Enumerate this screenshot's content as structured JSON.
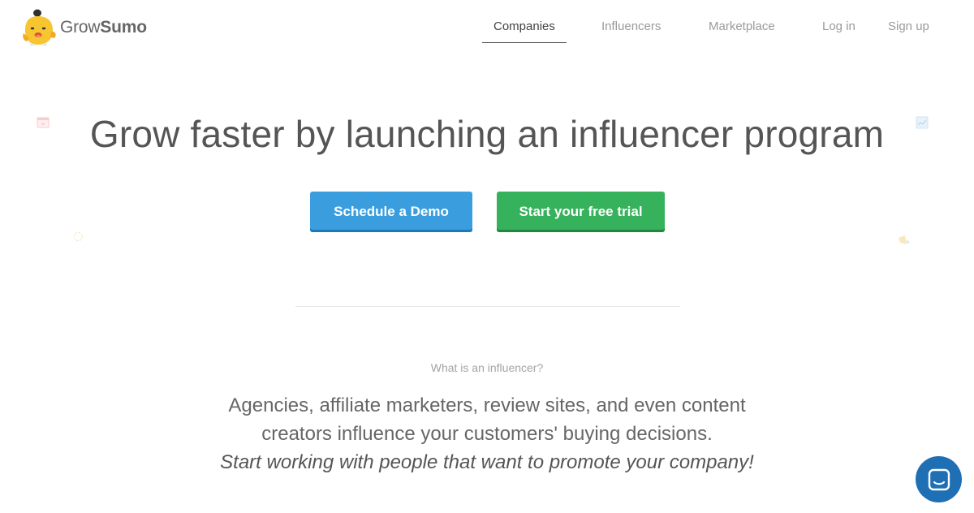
{
  "brand": {
    "name_light": "Grow",
    "name_bold": "Sumo"
  },
  "nav": {
    "items": [
      {
        "label": "Companies",
        "active": true
      },
      {
        "label": "Influencers",
        "active": false
      },
      {
        "label": "Marketplace",
        "active": false
      },
      {
        "label": "Log in",
        "active": false
      },
      {
        "label": "Sign up",
        "active": false
      }
    ]
  },
  "hero": {
    "title": "Grow faster by launching an influencer program",
    "demo_button": "Schedule a Demo",
    "trial_button": "Start your free trial"
  },
  "intro": {
    "question": "What is an influencer?",
    "line1": "Agencies, affiliate marketers, review sites, and even content",
    "line2": "creators influence your customers' buying decisions.",
    "line3": "Start working with people that want to promote your company!"
  },
  "colors": {
    "demo_button": "#3a9ede",
    "trial_button": "#35b25b",
    "chat_launcher": "#1f6fb5",
    "mascot": "#f7c530"
  },
  "icons": {
    "logo": "sumo-mascot-icon",
    "chat": "chat-bubble-icon",
    "decorations": [
      "calendar-icon",
      "chart-icon",
      "target-icon",
      "megaphone-icon"
    ]
  }
}
